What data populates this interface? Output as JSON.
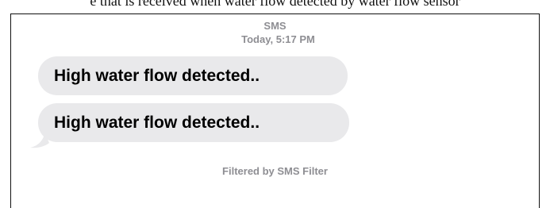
{
  "caption": "e that is received when water flow detected by water flow sensor",
  "thread": {
    "service": "SMS",
    "timestamp": "Today, 5:17 PM"
  },
  "messages": [
    {
      "text": "High water flow detected.."
    },
    {
      "text": "High water flow detected.."
    }
  ],
  "footer": "Filtered by SMS Filter",
  "colors": {
    "bubble": "#e9e9eb",
    "meta_text": "#8e8e93"
  }
}
